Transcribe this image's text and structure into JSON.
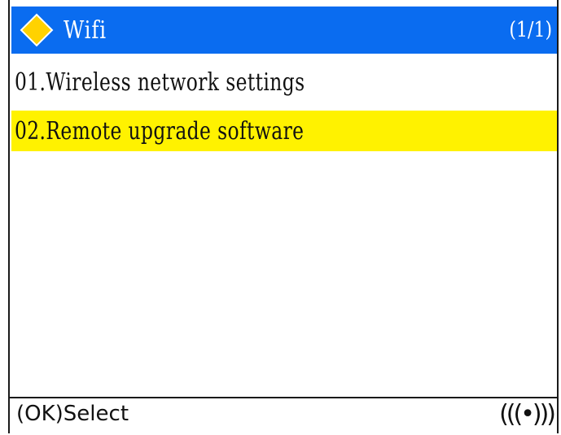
{
  "header": {
    "icon": "diamond-icon",
    "title": "Wifi",
    "page_indicator": "(1/1)"
  },
  "menu": {
    "items": [
      {
        "label": "01.Wireless network settings",
        "selected": false
      },
      {
        "label": "02.Remote upgrade software",
        "selected": true
      }
    ]
  },
  "footer": {
    "hint": "(OK)Select",
    "signal_icon": "wireless-signal-icon",
    "signal_glyph": "(((•)))"
  },
  "colors": {
    "title_bar": "#0a6cf0",
    "highlight": "#fff200",
    "diamond": "#ffd200"
  }
}
